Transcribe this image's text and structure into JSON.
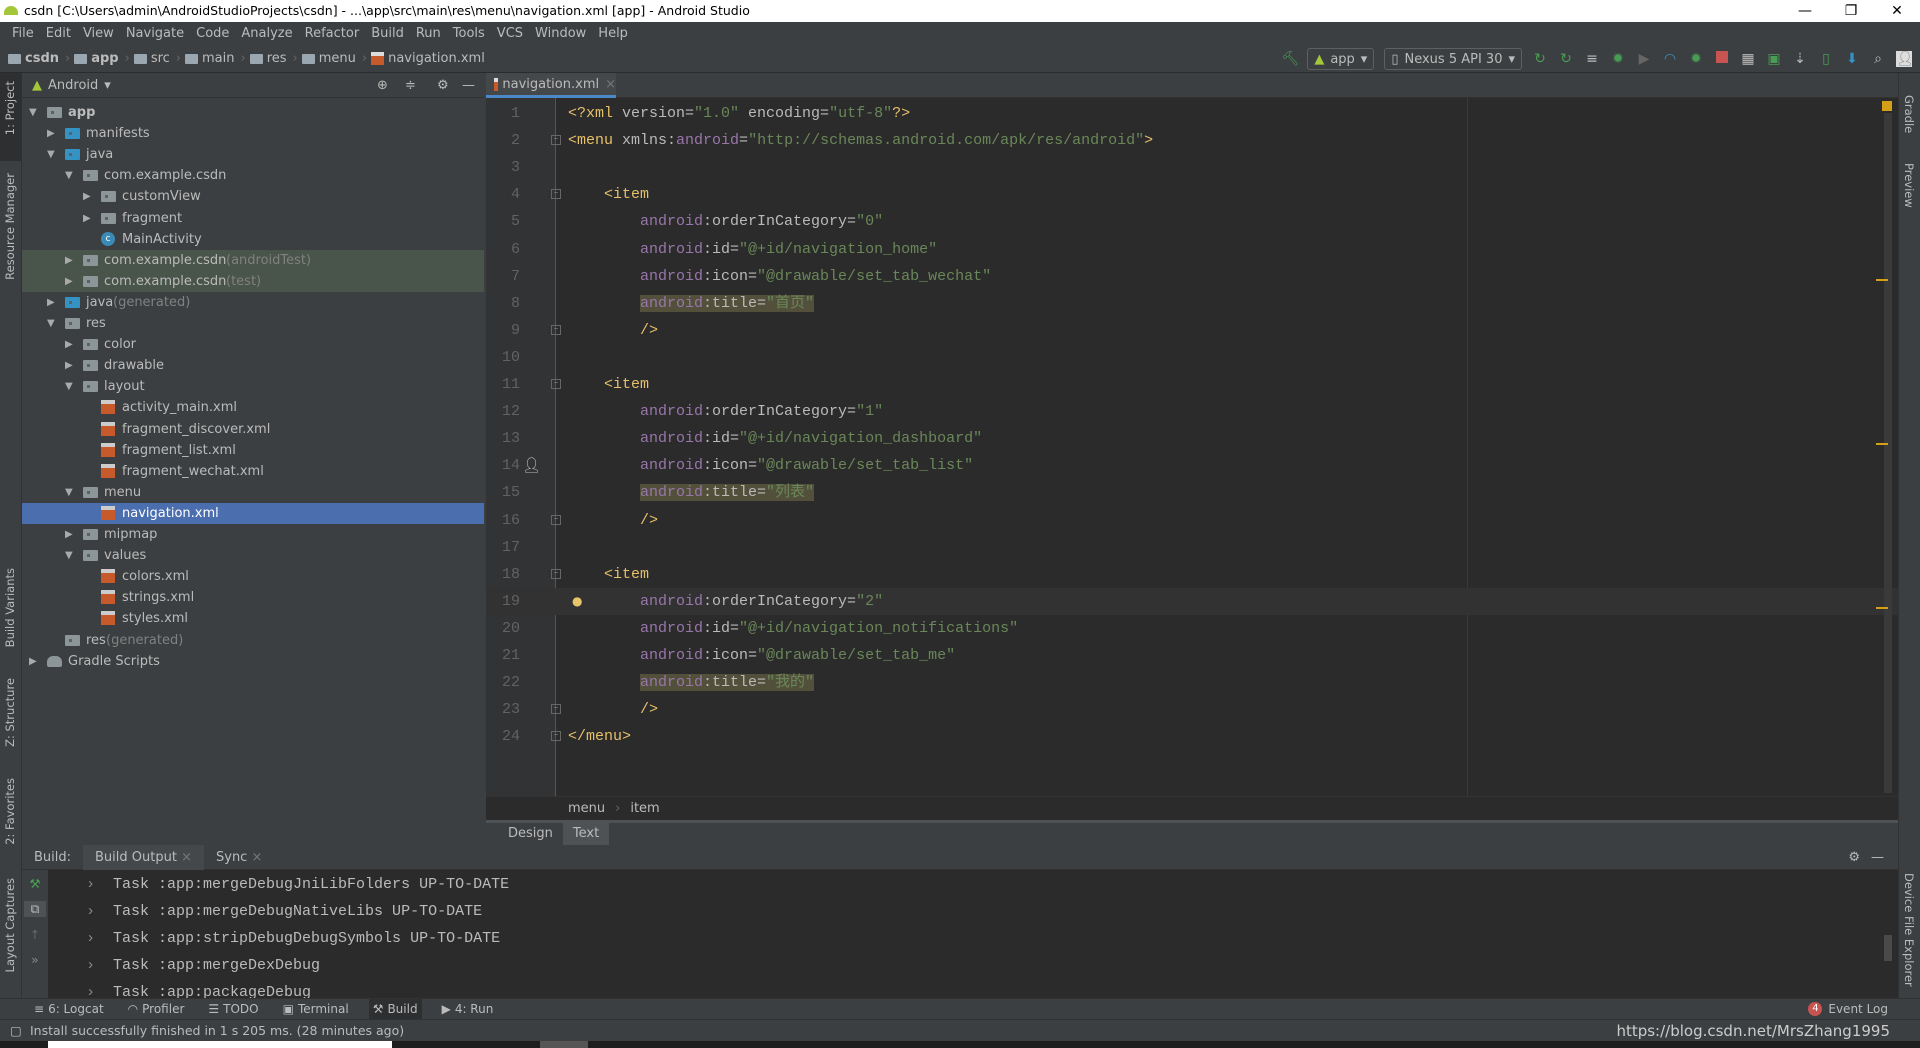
{
  "window": {
    "title": "csdn [C:\\Users\\admin\\AndroidStudioProjects\\csdn] - ...\\app\\src\\main\\res\\menu\\navigation.xml [app] - Android Studio"
  },
  "menu": [
    "File",
    "Edit",
    "View",
    "Navigate",
    "Code",
    "Analyze",
    "Refactor",
    "Build",
    "Run",
    "Tools",
    "VCS",
    "Window",
    "Help"
  ],
  "breadcrumb": [
    "csdn",
    "app",
    "src",
    "main",
    "res",
    "menu",
    "navigation.xml"
  ],
  "toolbar": {
    "config": "app",
    "device": "Nexus 5 API 30"
  },
  "left_strip": [
    "1: Project",
    "Resource Manager",
    "Build Variants",
    "Z: Structure",
    "2: Favorites",
    "Layout Captures"
  ],
  "right_strip": [
    "Gradle",
    "Preview",
    "Device File Explorer"
  ],
  "project": {
    "view": "Android",
    "tree": [
      {
        "level": 0,
        "state": "open",
        "icon": "module",
        "label": "app",
        "suffix": "",
        "style": ""
      },
      {
        "level": 1,
        "state": "closed",
        "icon": "folder-blue",
        "label": "manifests",
        "suffix": "",
        "style": ""
      },
      {
        "level": 1,
        "state": "open",
        "icon": "folder-blue",
        "label": "java",
        "suffix": "",
        "style": ""
      },
      {
        "level": 2,
        "state": "open",
        "icon": "folder",
        "label": "com.example.csdn",
        "suffix": "",
        "style": ""
      },
      {
        "level": 3,
        "state": "closed",
        "icon": "folder",
        "label": "customView",
        "suffix": "",
        "style": ""
      },
      {
        "level": 3,
        "state": "closed",
        "icon": "folder",
        "label": "fragment",
        "suffix": "",
        "style": ""
      },
      {
        "level": 3,
        "state": "none",
        "icon": "class",
        "label": "MainActivity",
        "suffix": "",
        "style": ""
      },
      {
        "level": 2,
        "state": "closed",
        "icon": "folder",
        "label": "com.example.csdn",
        "suffix": " (androidTest)",
        "style": "test"
      },
      {
        "level": 2,
        "state": "closed",
        "icon": "folder",
        "label": "com.example.csdn",
        "suffix": " (test)",
        "style": "test"
      },
      {
        "level": 1,
        "state": "closed",
        "icon": "folder-blue",
        "label": "java",
        "suffix": " (generated)",
        "style": ""
      },
      {
        "level": 1,
        "state": "open",
        "icon": "folder",
        "label": "res",
        "suffix": "",
        "style": ""
      },
      {
        "level": 2,
        "state": "closed",
        "icon": "folder",
        "label": "color",
        "suffix": "",
        "style": ""
      },
      {
        "level": 2,
        "state": "closed",
        "icon": "folder",
        "label": "drawable",
        "suffix": "",
        "style": ""
      },
      {
        "level": 2,
        "state": "open",
        "icon": "folder",
        "label": "layout",
        "suffix": "",
        "style": ""
      },
      {
        "level": 3,
        "state": "none",
        "icon": "xml",
        "label": "activity_main.xml",
        "suffix": "",
        "style": ""
      },
      {
        "level": 3,
        "state": "none",
        "icon": "xml",
        "label": "fragment_discover.xml",
        "suffix": "",
        "style": ""
      },
      {
        "level": 3,
        "state": "none",
        "icon": "xml",
        "label": "fragment_list.xml",
        "suffix": "",
        "style": ""
      },
      {
        "level": 3,
        "state": "none",
        "icon": "xml",
        "label": "fragment_wechat.xml",
        "suffix": "",
        "style": ""
      },
      {
        "level": 2,
        "state": "open",
        "icon": "folder",
        "label": "menu",
        "suffix": "",
        "style": ""
      },
      {
        "level": 3,
        "state": "none",
        "icon": "xml",
        "label": "navigation.xml",
        "suffix": "",
        "style": "sel"
      },
      {
        "level": 2,
        "state": "closed",
        "icon": "folder",
        "label": "mipmap",
        "suffix": "",
        "style": ""
      },
      {
        "level": 2,
        "state": "open",
        "icon": "folder",
        "label": "values",
        "suffix": "",
        "style": ""
      },
      {
        "level": 3,
        "state": "none",
        "icon": "xml",
        "label": "colors.xml",
        "suffix": "",
        "style": ""
      },
      {
        "level": 3,
        "state": "none",
        "icon": "xml",
        "label": "strings.xml",
        "suffix": "",
        "style": ""
      },
      {
        "level": 3,
        "state": "none",
        "icon": "xml",
        "label": "styles.xml",
        "suffix": "",
        "style": ""
      },
      {
        "level": 1,
        "state": "none",
        "icon": "folder",
        "label": "res",
        "suffix": " (generated)",
        "style": ""
      },
      {
        "level": 0,
        "state": "closed",
        "icon": "gradle",
        "label": "Gradle Scripts",
        "suffix": "",
        "style": ""
      }
    ]
  },
  "editor": {
    "tab": "navigation.xml",
    "current_line": 19,
    "lines": [
      [
        [
          "tag",
          "<?xml "
        ],
        [
          "attr",
          "version="
        ],
        [
          "str",
          "\"1.0\" "
        ],
        [
          "attr",
          "encoding="
        ],
        [
          "str",
          "\"utf-8\""
        ],
        [
          "tag",
          "?>"
        ]
      ],
      [
        [
          "tag",
          "<menu "
        ],
        [
          "attr",
          "xmlns:"
        ],
        [
          "ns",
          "android"
        ],
        [
          "attr",
          "="
        ],
        [
          "str",
          "\"http://schemas.android.com/apk/res/android\""
        ],
        [
          "tag",
          ">"
        ]
      ],
      [],
      [
        [
          "tag",
          "    <item"
        ]
      ],
      [
        [
          "plain",
          "        "
        ],
        [
          "ns",
          "android"
        ],
        [
          "attr",
          ":orderInCategory="
        ],
        [
          "str",
          "\"0\""
        ]
      ],
      [
        [
          "plain",
          "        "
        ],
        [
          "ns",
          "android"
        ],
        [
          "attr",
          ":id="
        ],
        [
          "str",
          "\"@+id/navigation_home\""
        ]
      ],
      [
        [
          "plain",
          "        "
        ],
        [
          "ns",
          "android"
        ],
        [
          "attr",
          ":icon="
        ],
        [
          "str",
          "\"@drawable/set_tab_wechat\""
        ]
      ],
      [
        [
          "plain",
          "        "
        ],
        [
          "ns hl",
          "android"
        ],
        [
          "attr hl",
          ":title="
        ],
        [
          "str hl",
          "\"首页\""
        ]
      ],
      [
        [
          "tag",
          "        />"
        ]
      ],
      [],
      [
        [
          "tag",
          "    <item"
        ]
      ],
      [
        [
          "plain",
          "        "
        ],
        [
          "ns",
          "android"
        ],
        [
          "attr",
          ":orderInCategory="
        ],
        [
          "str",
          "\"1\""
        ]
      ],
      [
        [
          "plain",
          "        "
        ],
        [
          "ns",
          "android"
        ],
        [
          "attr",
          ":id="
        ],
        [
          "str",
          "\"@+id/navigation_dashboard\""
        ]
      ],
      [
        [
          "plain",
          "        "
        ],
        [
          "ns",
          "android"
        ],
        [
          "attr",
          ":icon="
        ],
        [
          "str",
          "\"@drawable/set_tab_list\""
        ]
      ],
      [
        [
          "plain",
          "        "
        ],
        [
          "ns hl",
          "android"
        ],
        [
          "attr hl",
          ":title="
        ],
        [
          "str hl",
          "\"列表\""
        ]
      ],
      [
        [
          "tag",
          "        />"
        ]
      ],
      [],
      [
        [
          "tag",
          "    <item"
        ]
      ],
      [
        [
          "plain",
          "        "
        ],
        [
          "ns",
          "android"
        ],
        [
          "attr",
          ":orderInCategory="
        ],
        [
          "str",
          "\"2\""
        ]
      ],
      [
        [
          "plain",
          "        "
        ],
        [
          "ns",
          "android"
        ],
        [
          "attr",
          ":id="
        ],
        [
          "str",
          "\"@+id/navigation_notifications\""
        ]
      ],
      [
        [
          "plain",
          "        "
        ],
        [
          "ns",
          "android"
        ],
        [
          "attr",
          ":icon="
        ],
        [
          "str",
          "\"@drawable/set_tab_me\""
        ]
      ],
      [
        [
          "plain",
          "        "
        ],
        [
          "ns hl",
          "android"
        ],
        [
          "attr hl",
          ":title="
        ],
        [
          "str hl",
          "\"我的\""
        ]
      ],
      [
        [
          "tag",
          "        />"
        ]
      ],
      [
        [
          "tag",
          "</menu>"
        ]
      ]
    ],
    "folds": [
      2,
      4,
      9,
      11,
      16,
      18,
      23,
      24
    ],
    "breadcrumb": [
      "menu",
      "item"
    ],
    "mode_tabs": [
      "Design",
      "Text"
    ],
    "active_mode": "Text"
  },
  "build": {
    "label": "Build:",
    "tabs": [
      "Build Output",
      "Sync"
    ],
    "lines": [
      "Task :app:mergeDebugJniLibFolders UP-TO-DATE",
      "Task :app:mergeDebugNativeLibs UP-TO-DATE",
      "Task :app:stripDebugDebugSymbols UP-TO-DATE",
      "Task :app:mergeDexDebug",
      "Task :app:packageDebug"
    ]
  },
  "bottom_tools": [
    "6: Logcat",
    "Profiler",
    "TODO",
    "Terminal",
    "Build",
    "4: Run"
  ],
  "active_tool": "Build",
  "event_log": {
    "count": "4",
    "label": "Event Log"
  },
  "status": {
    "message": "Install successfully finished in 1 s 205 ms. (28 minutes ago)",
    "watermark": "https://blog.csdn.net/MrsZhang1995"
  },
  "colors": {
    "tag": "#e8bf6a",
    "namespace": "#9876aa",
    "attribute": "#bababa",
    "string": "#6a8759",
    "selection": "#4b6eaf",
    "background": "#2b2b2b"
  }
}
